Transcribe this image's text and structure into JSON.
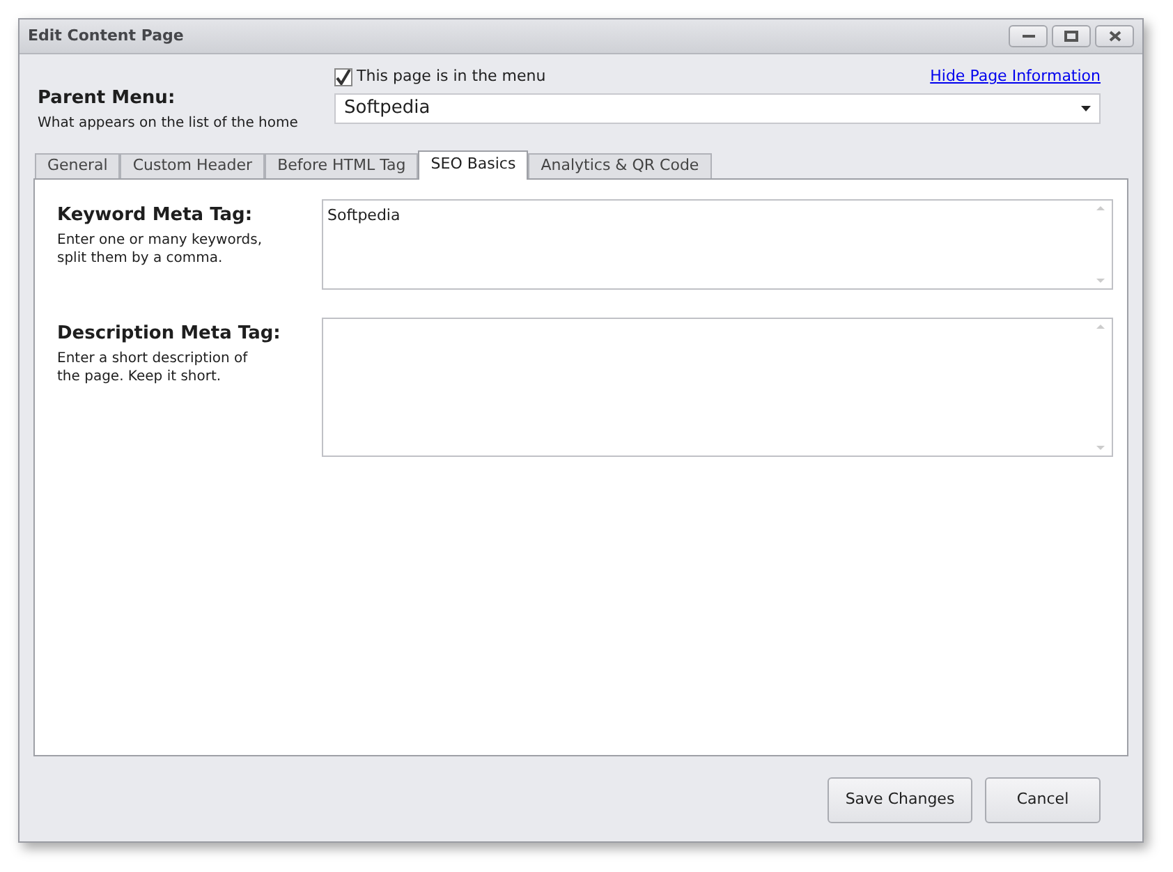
{
  "window": {
    "title": "Edit Content Page"
  },
  "parent_menu": {
    "label": "Parent Menu:",
    "hint": "What appears on the list of the home",
    "in_menu": {
      "label": "This page is in the menu",
      "checked": true
    },
    "value": "Softpedia"
  },
  "hide_link": "Hide Page Information",
  "tabs": [
    {
      "label": "General",
      "selected": false
    },
    {
      "label": "Custom Header",
      "selected": false
    },
    {
      "label": "Before HTML Tag",
      "selected": false
    },
    {
      "label": "SEO Basics",
      "selected": true
    },
    {
      "label": "Analytics & QR Code",
      "selected": false
    }
  ],
  "fields": [
    {
      "label": "Keyword Meta Tag:",
      "hint": "Enter one or many keywords, split them by a comma.",
      "value": "Softpedia"
    },
    {
      "label": "Description Meta Tag:",
      "hint": "Enter a short description of the page. Keep it short."
    }
  ],
  "buttons": [
    "Save Changes",
    "Cancel"
  ]
}
